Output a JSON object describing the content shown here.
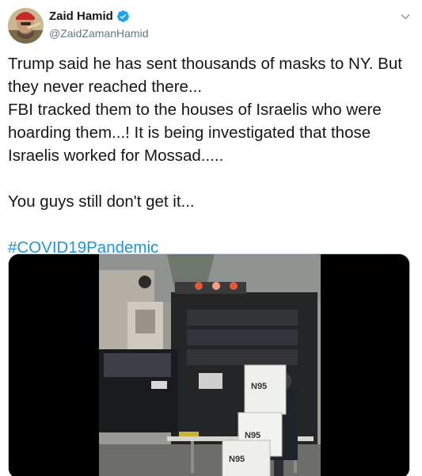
{
  "author": {
    "name": "Zaid Hamid",
    "handle": "@ZaidZamanHamid",
    "verified": true
  },
  "tweet": {
    "lines": [
      "Trump said he has sent thousands of masks to NY. But",
      "they never reached there...",
      "FBI tracked them to the houses of Israelis who were",
      "hoarding them...! It is being investigated that those",
      "Israelis worked for Mossad....."
    ],
    "line2": "You guys still don't get it...",
    "hashtag": "#COVID19Pandemic"
  },
  "media": {
    "type": "video",
    "box_labels": [
      "N95",
      "N95",
      "N95"
    ]
  },
  "colors": {
    "link": "#1b95e0",
    "verified": "#1da1f2",
    "text": "#14171a",
    "secondary": "#657786"
  },
  "icons": {
    "verified": "verified-badge-icon",
    "menu": "chevron-down-icon"
  }
}
